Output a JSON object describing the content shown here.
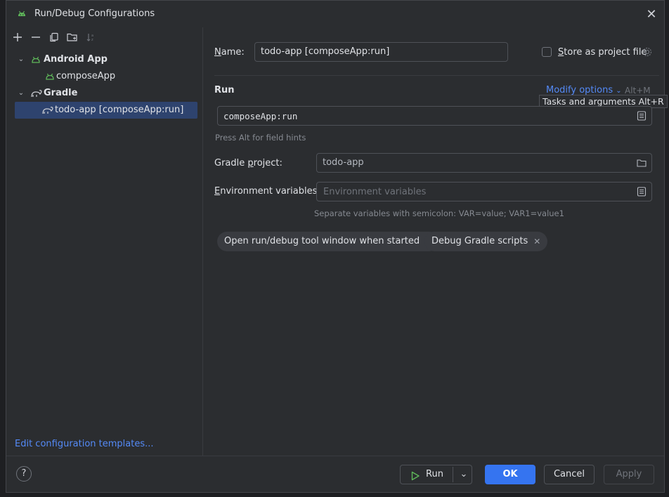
{
  "window": {
    "title": "Run/Debug Configurations"
  },
  "toolbar": {
    "add": "+",
    "remove": "—"
  },
  "tree": {
    "items": [
      {
        "label": "Android App"
      },
      {
        "label": "composeApp"
      },
      {
        "label": "Gradle"
      },
      {
        "label": "todo-app [composeApp:run]"
      }
    ]
  },
  "left": {
    "edit_templates": "Edit configuration templates..."
  },
  "form": {
    "name_label_prefix": "",
    "name_label_underlined": "N",
    "name_label_rest": "ame:",
    "name_value": "todo-app [composeApp:run]",
    "store_label_underlined": "S",
    "store_label_rest": "tore as project file",
    "run_heading": "Run",
    "modify_options": "Modify options",
    "modify_shortcut": "Alt+M",
    "tooltip": "Tasks and arguments Alt+R",
    "tasks_value": "composeApp:run",
    "field_hint": "Press Alt for field hints",
    "gradle_project_label_a": "Gradle ",
    "gradle_project_label_u": "p",
    "gradle_project_label_b": "roject:",
    "gradle_project_value": "todo-app",
    "env_label_u": "E",
    "env_label_rest": "nvironment variables:",
    "env_placeholder": "Environment variables",
    "env_hint": "Separate variables with semicolon: VAR=value; VAR1=value1",
    "chips": [
      {
        "label": "Open run/debug tool window when started"
      },
      {
        "label": "Debug Gradle scripts"
      }
    ]
  },
  "footer": {
    "help": "?",
    "run": "Run",
    "ok": "OK",
    "cancel": "Cancel",
    "apply": "Apply"
  },
  "colors": {
    "accent": "#3574f0",
    "link": "#548af7",
    "selection": "#2e436e",
    "android_green": "#5fb85a"
  }
}
